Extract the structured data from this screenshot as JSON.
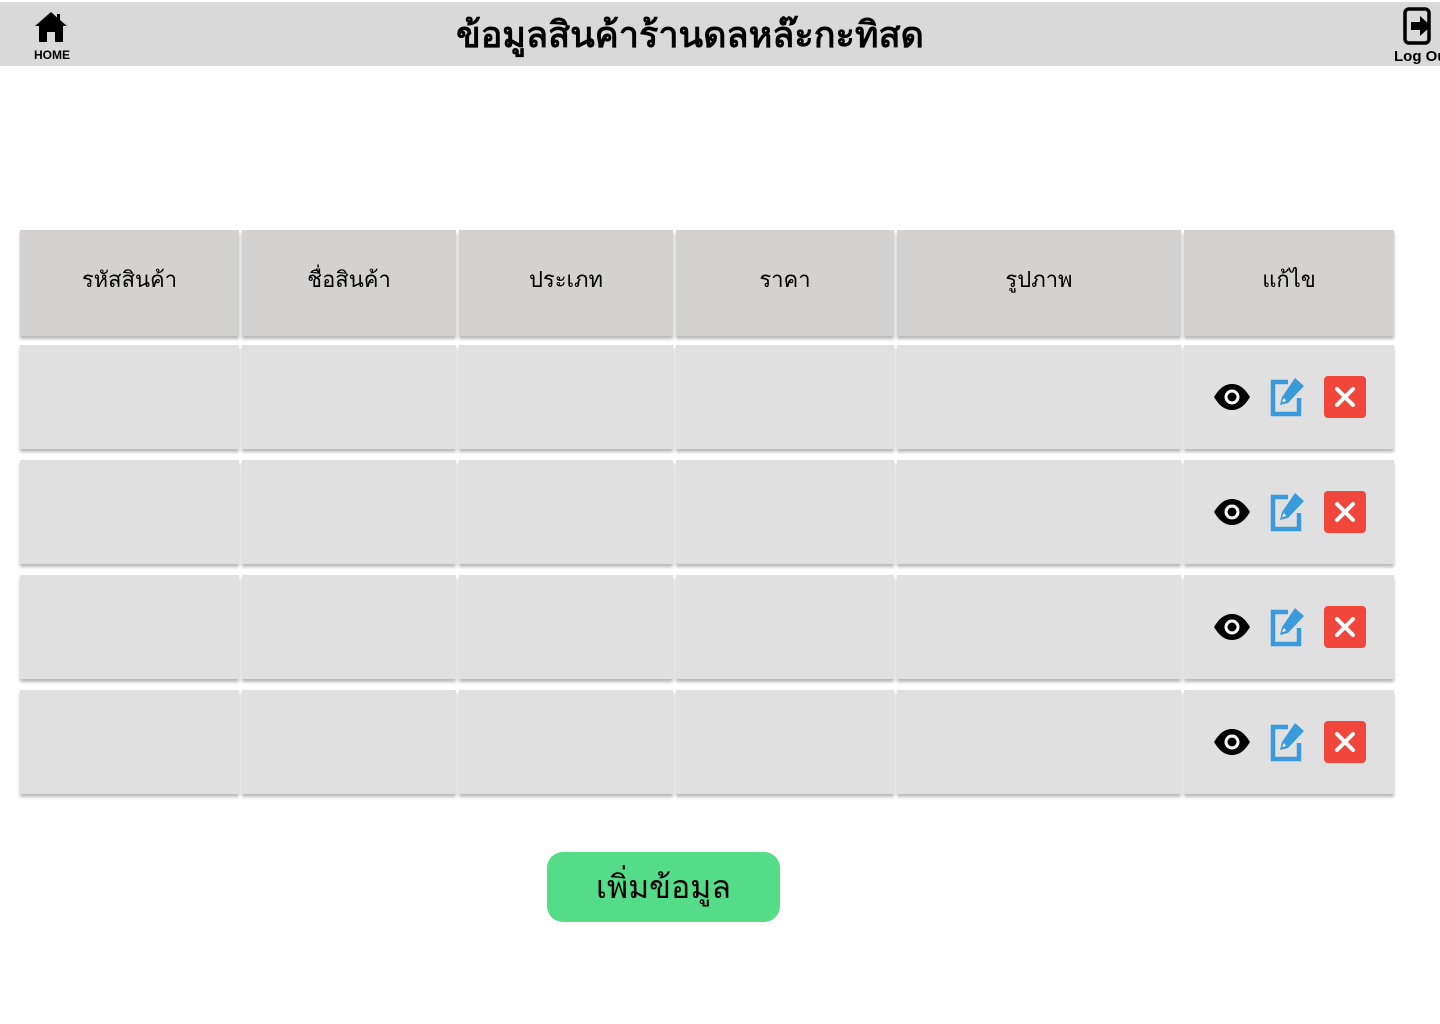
{
  "header": {
    "title": "ข้อมูลสินค้าร้านดลหล๊ะกะทิสด",
    "home_label": "HOME",
    "logout_label": "Log Ou",
    "background": "#d9d9d9"
  },
  "table": {
    "columns": [
      "รหัสสินค้า",
      "ชื่อสินค้า",
      "ประเภท",
      "ราคา",
      "รูปภาพ",
      "แก้ไข"
    ],
    "rows": [
      {
        "cells": [
          "",
          "",
          "",
          "",
          ""
        ],
        "actions": [
          "eye-icon",
          "edit-icon",
          "close-icon"
        ]
      },
      {
        "cells": [
          "",
          "",
          "",
          "",
          ""
        ],
        "actions": [
          "eye-icon",
          "edit-icon",
          "close-icon"
        ]
      },
      {
        "cells": [
          "",
          "",
          "",
          "",
          ""
        ],
        "actions": [
          "eye-icon",
          "edit-icon",
          "close-icon"
        ]
      },
      {
        "cells": [
          "",
          "",
          "",
          "",
          ""
        ],
        "actions": [
          "eye-icon",
          "edit-icon",
          "close-icon"
        ]
      }
    ],
    "header_color": "#d3d2d1",
    "row_color": "#e1e0e1"
  },
  "colors": {
    "edit": "#3a9bdc",
    "delete": "#f0463c",
    "add_button": "#54dc88"
  },
  "add_button": {
    "label": "เพิ่มข้อมูล"
  }
}
